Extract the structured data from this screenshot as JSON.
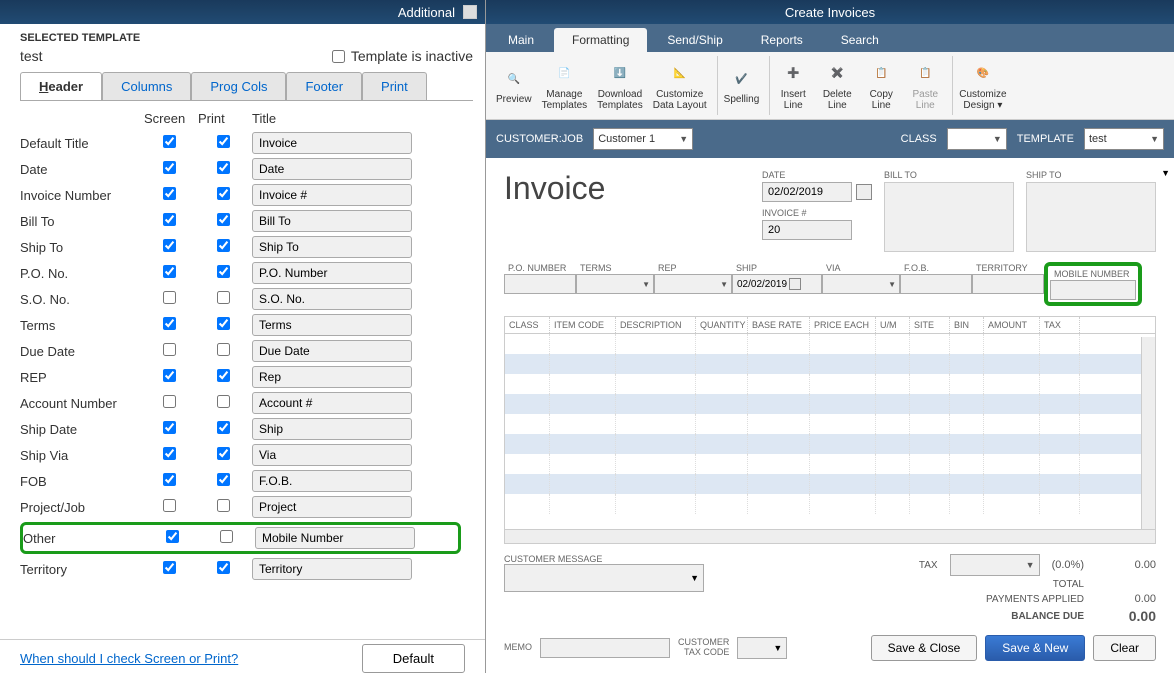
{
  "left": {
    "title": "Additional",
    "selected_template_label": "SELECTED TEMPLATE",
    "template_name": "test",
    "inactive_label": "Template is inactive",
    "tabs": {
      "header": "Header",
      "columns": "Columns",
      "prog": "Prog Cols",
      "footer": "Footer",
      "print": "Print"
    },
    "col_screen": "Screen",
    "col_print": "Print",
    "col_title": "Title",
    "rows": [
      {
        "label": "Default Title",
        "screen": true,
        "print": true,
        "title": "Invoice"
      },
      {
        "label": "Date",
        "screen": true,
        "print": true,
        "title": "Date"
      },
      {
        "label": "Invoice Number",
        "screen": true,
        "print": true,
        "title": "Invoice #"
      },
      {
        "label": "Bill To",
        "screen": true,
        "print": true,
        "title": "Bill To"
      },
      {
        "label": "Ship To",
        "screen": true,
        "print": true,
        "title": "Ship To"
      },
      {
        "label": "P.O. No.",
        "screen": true,
        "print": true,
        "title": "P.O. Number"
      },
      {
        "label": "S.O. No.",
        "screen": false,
        "print": false,
        "title": "S.O. No."
      },
      {
        "label": "Terms",
        "screen": true,
        "print": true,
        "title": "Terms"
      },
      {
        "label": "Due Date",
        "screen": false,
        "print": false,
        "title": "Due Date"
      },
      {
        "label": "REP",
        "screen": true,
        "print": true,
        "title": "Rep"
      },
      {
        "label": "Account Number",
        "screen": false,
        "print": false,
        "title": "Account #"
      },
      {
        "label": "Ship Date",
        "screen": true,
        "print": true,
        "title": "Ship"
      },
      {
        "label": "Ship Via",
        "screen": true,
        "print": true,
        "title": "Via"
      },
      {
        "label": "FOB",
        "screen": true,
        "print": true,
        "title": "F.O.B."
      },
      {
        "label": "Project/Job",
        "screen": false,
        "print": false,
        "title": "Project"
      },
      {
        "label": "Other",
        "screen": true,
        "print": false,
        "title": "Mobile Number",
        "highlight": true
      },
      {
        "label": "Territory",
        "screen": true,
        "print": true,
        "title": "Territory"
      }
    ],
    "link": "When should I check Screen or Print?",
    "default_btn": "Default"
  },
  "right": {
    "title": "Create Invoices",
    "tabs": {
      "main": "Main",
      "formatting": "Formatting",
      "sendship": "Send/Ship",
      "reports": "Reports",
      "search": "Search"
    },
    "ribbon": {
      "preview": "Preview",
      "manage": "Manage\nTemplates",
      "download": "Download\nTemplates",
      "customize_layout": "Customize\nData Layout",
      "spelling": "Spelling",
      "insert": "Insert\nLine",
      "delete": "Delete\nLine",
      "copy": "Copy\nLine",
      "paste": "Paste\nLine",
      "customize_design": "Customize\nDesign ▾"
    },
    "formbar": {
      "customer_job_lbl": "CUSTOMER:JOB",
      "customer_job_val": "Customer 1",
      "class_lbl": "CLASS",
      "template_lbl": "TEMPLATE",
      "template_val": "test"
    },
    "invoice": {
      "title": "Invoice",
      "date_lbl": "DATE",
      "date_val": "02/02/2019",
      "invno_lbl": "INVOICE #",
      "invno_val": "20",
      "billto_lbl": "BILL TO",
      "shipto_lbl": "SHIP TO",
      "fields": {
        "po": "P.O. NUMBER",
        "terms": "TERMS",
        "rep": "REP",
        "ship": "SHIP",
        "ship_val": "02/02/2019",
        "via": "VIA",
        "fob": "F.O.B.",
        "territory": "TERRITORY",
        "mobile": "MOBILE NUMBER"
      },
      "cols": [
        "CLASS",
        "ITEM CODE",
        "DESCRIPTION",
        "QUANTITY",
        "BASE RATE",
        "PRICE EACH",
        "U/M",
        "SITE",
        "BIN",
        "AMOUNT",
        "TAX"
      ],
      "totals": {
        "tax_lbl": "TAX",
        "tax_pct": "(0.0%)",
        "tax_val": "0.00",
        "total_lbl": "TOTAL",
        "payments_lbl": "PAYMENTS APPLIED",
        "payments_val": "0.00",
        "balance_lbl": "BALANCE DUE",
        "balance_val": "0.00"
      },
      "cust_msg_lbl": "CUSTOMER MESSAGE",
      "memo_lbl": "MEMO",
      "cust_tax_lbl": "CUSTOMER\nTAX CODE",
      "buttons": {
        "save_close": "Save & Close",
        "save_new": "Save & New",
        "clear": "Clear"
      }
    }
  }
}
